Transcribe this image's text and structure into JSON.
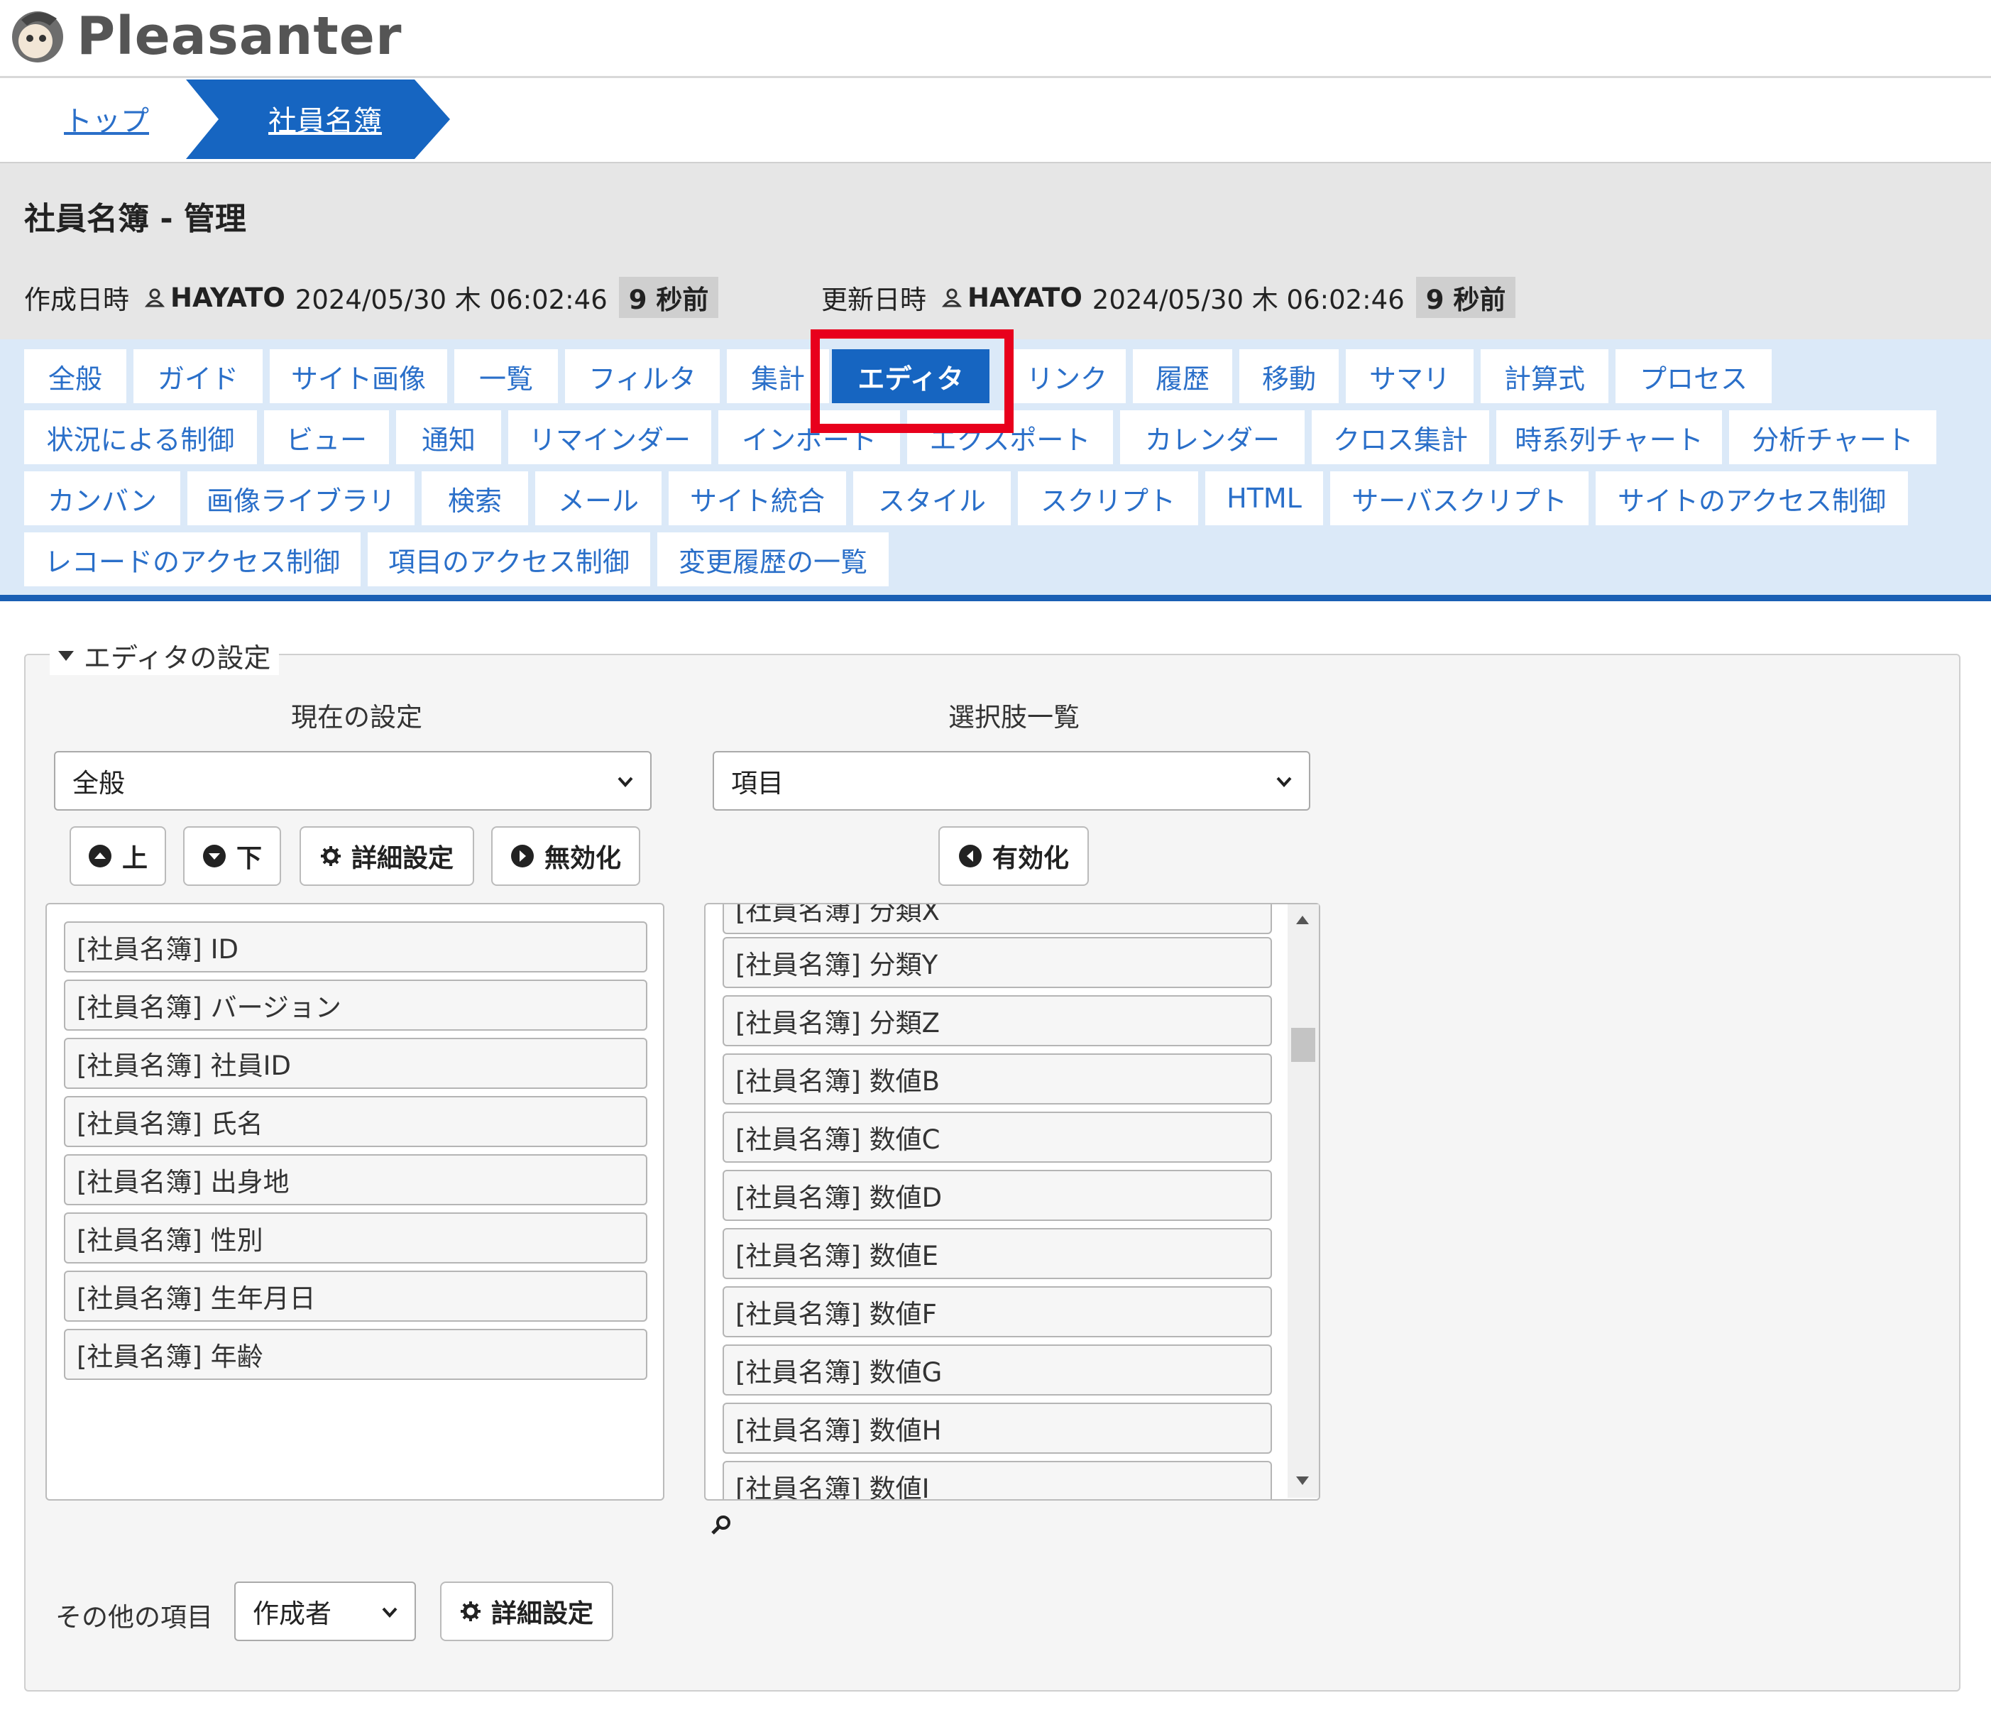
{
  "app": {
    "logo_text": "Pleasanter"
  },
  "breadcrumb": {
    "top": "トップ",
    "current": "社員名簿"
  },
  "title": "社員名簿 - 管理",
  "meta": {
    "created_label": "作成日時",
    "created_user": "HAYATO",
    "created_at": "2024/05/30 木 06:02:46",
    "created_ago": "9 秒前",
    "updated_label": "更新日時",
    "updated_user": "HAYATO",
    "updated_at": "2024/05/30 木 06:02:46",
    "updated_ago": "9 秒前"
  },
  "tabs": [
    "全般",
    "ガイド",
    "サイト画像",
    "一覧",
    "フィルタ",
    "集計",
    "エディタ",
    "リンク",
    "履歴",
    "移動",
    "サマリ",
    "計算式",
    "プロセス",
    "状況による制御",
    "ビュー",
    "通知",
    "リマインダー",
    "インポート",
    "エクスポート",
    "カレンダー",
    "クロス集計",
    "時系列チャート",
    "分析チャート",
    "カンバン",
    "画像ライブラリ",
    "検索",
    "メール",
    "サイト統合",
    "スタイル",
    "スクリプト",
    "HTML",
    "サーバスクリプト",
    "サイトのアクセス制御",
    "レコードのアクセス制御",
    "項目のアクセス制御",
    "変更履歴の一覧"
  ],
  "active_tab": "エディタ",
  "editor": {
    "legend": "エディタの設定",
    "current_header": "現在の設定",
    "options_header": "選択肢一覧",
    "current_select": "全般",
    "options_select": "項目",
    "btn_up": "上",
    "btn_down": "下",
    "btn_detail": "詳細設定",
    "btn_disable": "無効化",
    "btn_enable": "有効化",
    "current_items": [
      "[社員名簿] ID",
      "[社員名簿] バージョン",
      "[社員名簿] 社員ID",
      "[社員名簿] 氏名",
      "[社員名簿] 出身地",
      "[社員名簿] 性別",
      "[社員名簿] 生年月日",
      "[社員名簿] 年齢"
    ],
    "option_items": [
      "[社員名簿] 分類X",
      "[社員名簿] 分類Y",
      "[社員名簿] 分類Z",
      "[社員名簿] 数値B",
      "[社員名簿] 数値C",
      "[社員名簿] 数値D",
      "[社員名簿] 数値E",
      "[社員名簿] 数値F",
      "[社員名簿] 数値G",
      "[社員名簿] 数値H",
      "[社員名簿] 数値I"
    ],
    "other_label": "その他の項目",
    "other_select": "作成者",
    "other_detail": "詳細設定"
  },
  "colors": {
    "accent": "#1665c1",
    "tab_bg": "#dbe9f8",
    "highlight": "#e8001c",
    "link": "#2a6fc9"
  }
}
